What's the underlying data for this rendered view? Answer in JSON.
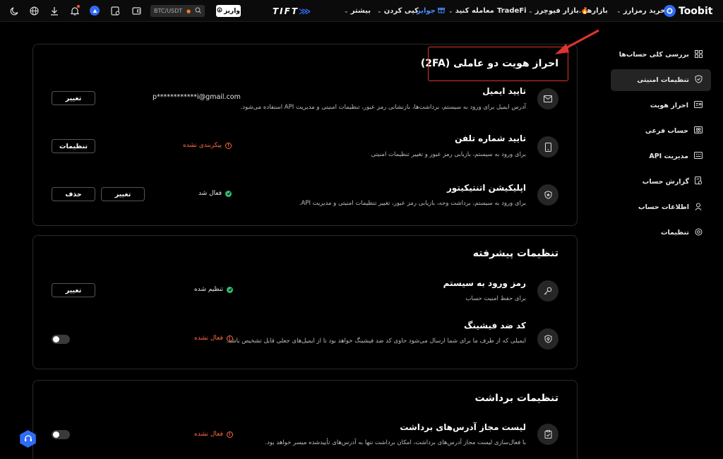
{
  "topnav": {
    "brand": "Toobit",
    "items": [
      {
        "label": "خرید رمزارز",
        "dropdown": true
      },
      {
        "label": "بازارها",
        "dropdown": true
      },
      {
        "label": "بازار فیوچرز",
        "dropdown": true
      },
      {
        "label": "TradeFi",
        "dropdown": false
      },
      {
        "label": "معامله کنید",
        "dropdown": true
      },
      {
        "label": "جوایز",
        "dropdown": false
      },
      {
        "label": "کپی کردن",
        "dropdown": true
      },
      {
        "label": "بیشتر",
        "dropdown": true
      }
    ],
    "center_logo": "TIFT",
    "login_label": "واریز",
    "search_placeholder": "BTC/USDT"
  },
  "sidebar": {
    "items": [
      {
        "label": "بررسی کلی حساب‌ها",
        "icon": "grid-icon"
      },
      {
        "label": "تنظیمات امنیتی",
        "icon": "shield-icon",
        "active": true
      },
      {
        "label": "احراز هویت",
        "icon": "id-card-icon"
      },
      {
        "label": "حساب فرعی",
        "icon": "users-icon"
      },
      {
        "label": "مدیریت API",
        "icon": "api-icon"
      },
      {
        "label": "گزارش حساب",
        "icon": "report-icon"
      },
      {
        "label": "اطلاعات حساب",
        "icon": "user-icon"
      },
      {
        "label": "تنظیمات",
        "icon": "gear-icon"
      }
    ]
  },
  "twofa": {
    "title": "احراز هویت دو عاملی (2FA)",
    "email": {
      "title": "تایید ایمیل",
      "desc": "آدرس ایمیل برای ورود به سیستم، برداشت‌ها، بازنشانی رمز عبور، تنظیمات امنیتی و مدیریت API استفاده می‌شود.",
      "value": "p************i@gmail.com",
      "button": "تغییر"
    },
    "phone": {
      "title": "تایید شماره تلفن",
      "desc": "برای ورود به سیستم، بازیابی رمز عبور و تغییر تنظیمات امنیتی",
      "status": "پیکربندی نشده",
      "button": "تنظیمات"
    },
    "authenticator": {
      "title": "اپلیکیشن اتنتیکیتور",
      "desc": "برای ورود به سیستم، برداشت وجه، بازیابی رمز عبور، تغییر تنظیمات امنیتی و مدیریت API.",
      "status": "فعال شد",
      "button_change": "تغییر",
      "button_delete": "حذف"
    }
  },
  "advanced": {
    "title": "تنظیمات پیشرفته",
    "password": {
      "title": "رمز ورود به سیستم",
      "desc": "برای حفظ امنیت حساب",
      "status": "تنظیم شده",
      "button": "تغییر"
    },
    "antiphishing": {
      "title": "کد ضد فیشینگ",
      "desc": "ایمیلی که از طرف ما برای شما ارسال می‌شود حاوی کد ضد فیشینگ خواهد بود تا از ایمیل‌های جعلی قابل تشخیص باشد.",
      "status": "فعال نشده",
      "enabled": false
    }
  },
  "withdrawal": {
    "title": "تنظیمات برداشت",
    "whitelist": {
      "title": "لیست مجاز آدرس‌های برداشت",
      "desc": "با فعال‌سازی لیست مجاز آدرس‌های برداشت، امکان برداشت تنها به آدرس‌های تأییدشده میسر خواهد بود.",
      "status": "فعال نشده",
      "enabled": false
    }
  },
  "colors": {
    "accent": "#2f6cf6",
    "highlight": "#e0342e",
    "warning": "#ff6b3d",
    "success": "#2fbf71"
  }
}
